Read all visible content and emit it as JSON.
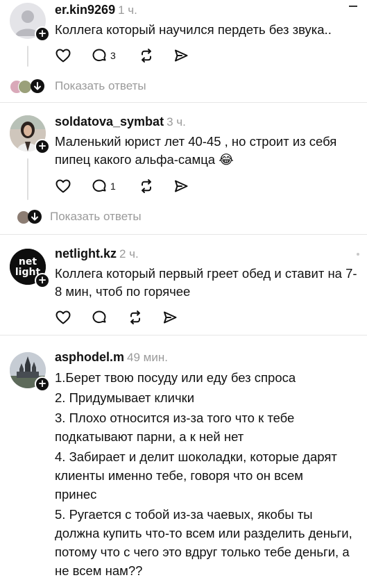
{
  "comments": [
    {
      "username": "er.kin9269",
      "time": "1 ч.",
      "text": "Коллега который научился пердеть без звука..",
      "avatar": "default-avatar-icon",
      "reply_count": "3",
      "show_replies": "Показать ответы"
    },
    {
      "username": "soldatova_symbat",
      "time": "3 ч.",
      "text": "Маленький юрист лет 40-45 , но строит из себя пипец какого альфа-самца 😂",
      "avatar": "user-photo",
      "reply_count": "1",
      "show_replies": "Показать ответы"
    },
    {
      "username": "netlight.kz",
      "time": "2 ч.",
      "text": "Коллега который первый греет обед и ставит на 7-8 мин, чтоб по горячее",
      "avatar": "netlight-logo",
      "avatar_text": "net light",
      "reply_count": ""
    },
    {
      "username": "asphodel.m",
      "time": "49 мин.",
      "avatar": "castle-photo",
      "lines": [
        "1.Берет твою посуду или еду без спроса",
        "2. Придумывает клички",
        "3. Плохо относится из-за того что к тебе подкатывают парни, а к ней нет",
        "4. Забирает и делит шоколадки, которые дарят клиенты именно тебе, говоря что он всем принес",
        "5. Ругается с тобой из-за чаевых, якобы ты должна купить что-то всем или разделить деньги, потому что с чего это вдруг только тебе деньги, а не всем нам??"
      ]
    }
  ],
  "colors": {
    "text": "#111111",
    "muted": "#9a9a9a",
    "divider": "#e6e6e6",
    "netlight_bg": "#0e0e0e"
  }
}
